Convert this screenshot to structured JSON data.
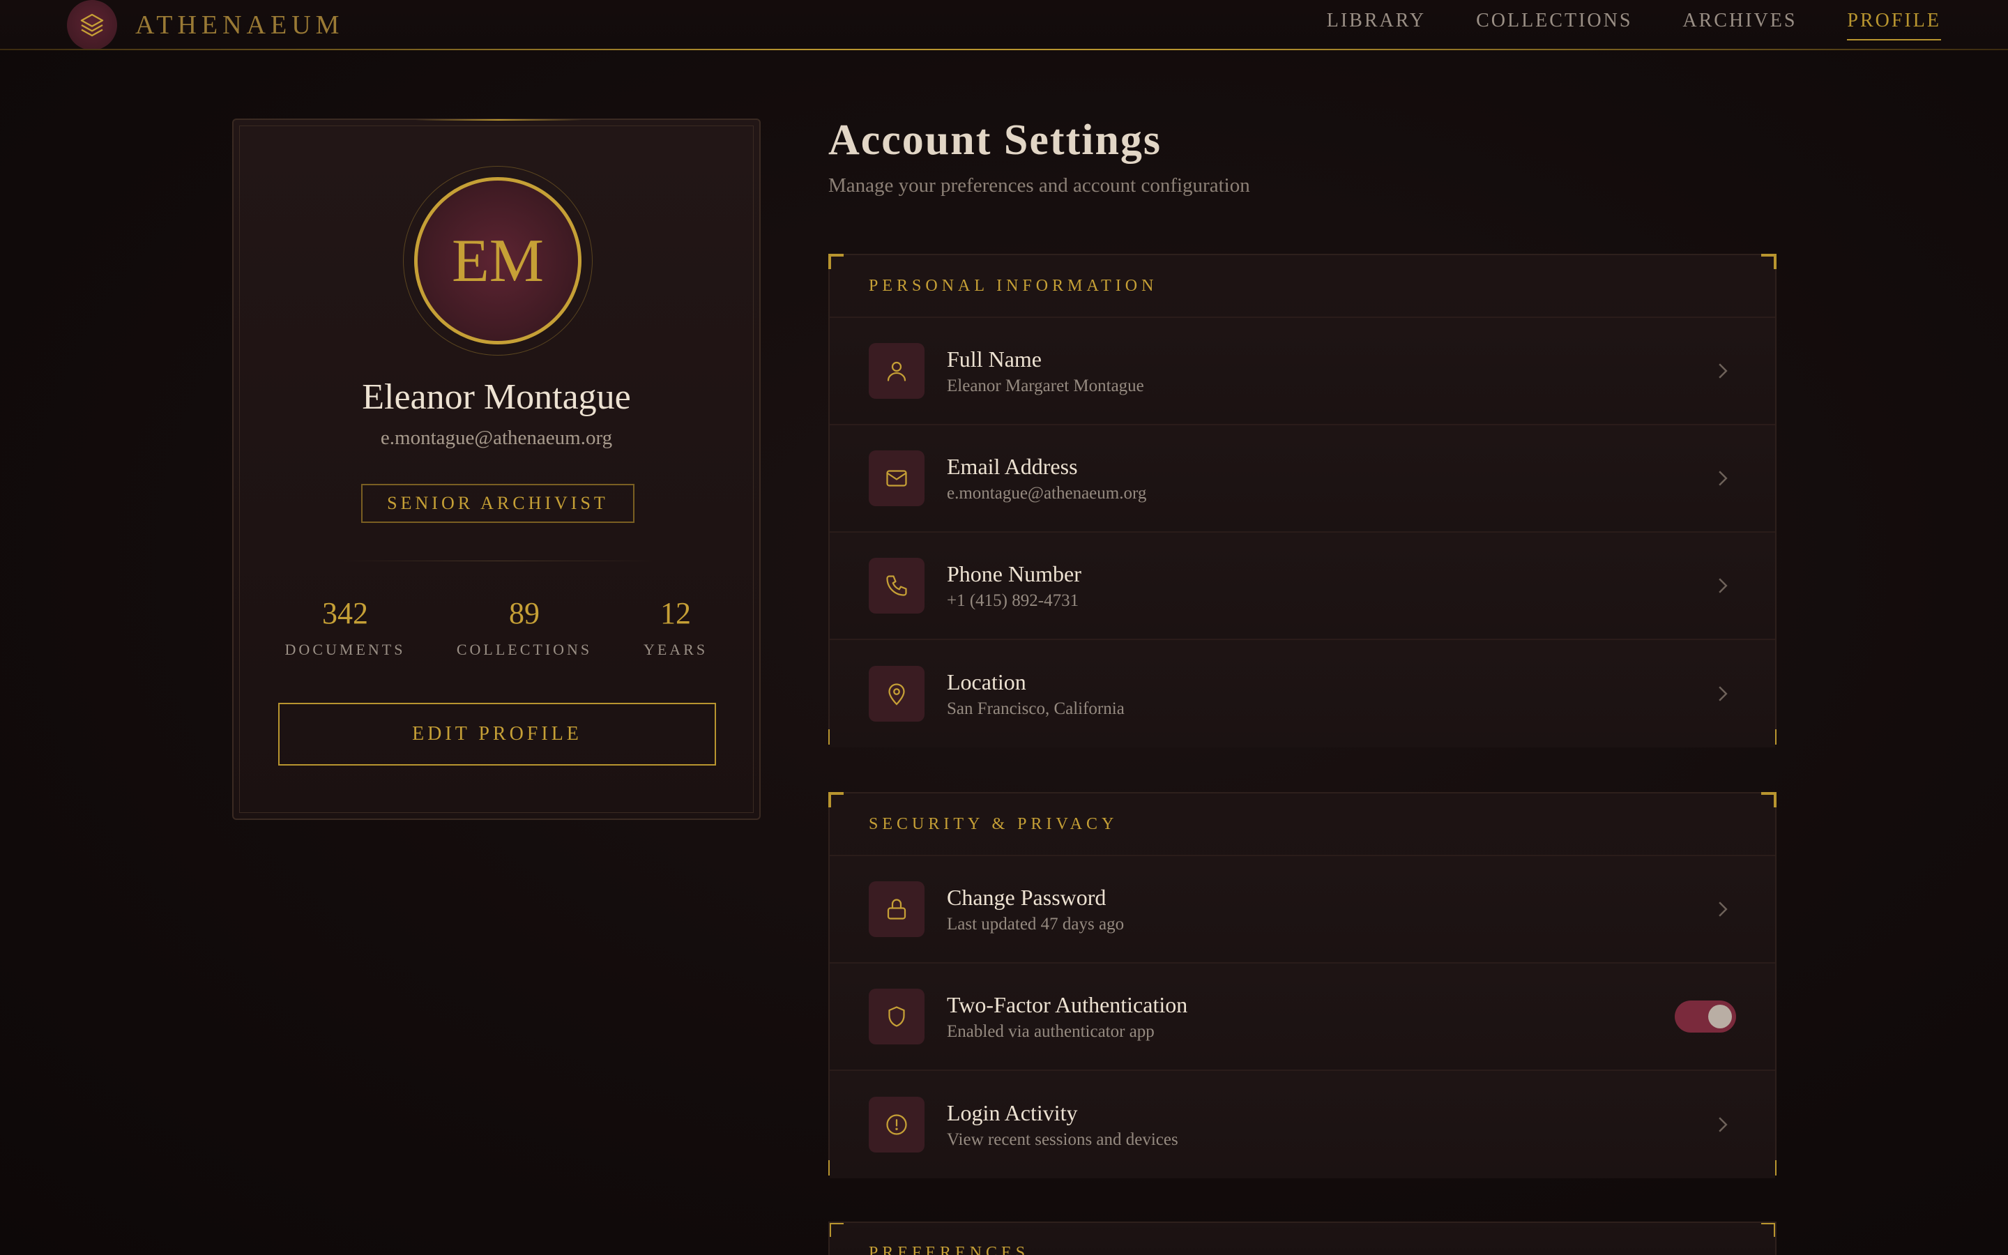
{
  "brand": {
    "name": "ATHENAEUM"
  },
  "nav": [
    {
      "label": "LIBRARY"
    },
    {
      "label": "COLLECTIONS"
    },
    {
      "label": "ARCHIVES"
    },
    {
      "label": "PROFILE",
      "active": true
    }
  ],
  "profile": {
    "initials": "EM",
    "name": "Eleanor Montague",
    "email": "e.montague@athenaeum.org",
    "role": "SENIOR ARCHIVIST",
    "stats": [
      {
        "value": "342",
        "label": "DOCUMENTS"
      },
      {
        "value": "89",
        "label": "COLLECTIONS"
      },
      {
        "value": "12",
        "label": "YEARS"
      }
    ],
    "edit_label": "EDIT PROFILE"
  },
  "page": {
    "title": "Account Settings",
    "subtitle": "Manage your preferences and account configuration"
  },
  "sections": {
    "personal": {
      "title": "PERSONAL INFORMATION",
      "rows": [
        {
          "title": "Full Name",
          "value": "Eleanor Margaret Montague",
          "icon": "user-icon"
        },
        {
          "title": "Email Address",
          "value": "e.montague@athenaeum.org",
          "icon": "mail-icon"
        },
        {
          "title": "Phone Number",
          "value": "+1 (415) 892-4731",
          "icon": "phone-icon"
        },
        {
          "title": "Location",
          "value": "San Francisco, California",
          "icon": "map-pin-icon"
        }
      ]
    },
    "security": {
      "title": "SECURITY & PRIVACY",
      "rows": [
        {
          "title": "Change Password",
          "value": "Last updated 47 days ago",
          "icon": "lock-icon"
        },
        {
          "title": "Two-Factor Authentication",
          "value": "Enabled via authenticator app",
          "icon": "shield-icon",
          "toggle_on": true
        },
        {
          "title": "Login Activity",
          "value": "View recent sessions and devices",
          "icon": "alert-circle-icon"
        }
      ]
    },
    "preferences": {
      "title": "PREFERENCES"
    }
  },
  "colors": {
    "accent": "#c6a036",
    "background": "#130c0c",
    "toggle": "#7a2a3c"
  }
}
